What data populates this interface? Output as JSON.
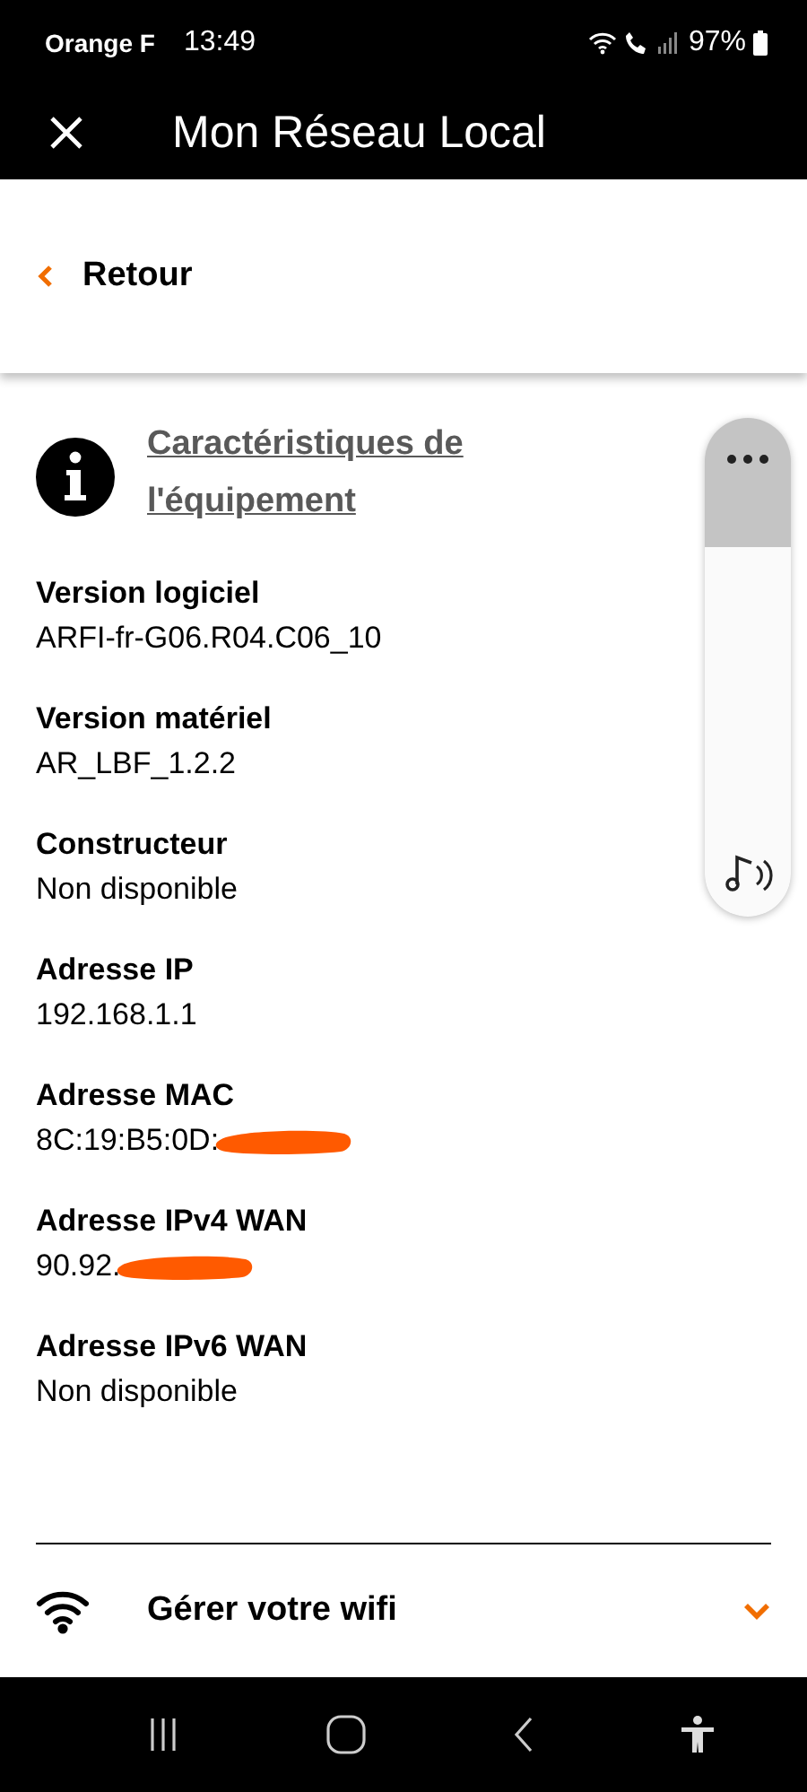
{
  "status_bar": {
    "carrier": "Orange F",
    "time": "13:49",
    "battery": "97%"
  },
  "window": {
    "title": "Mon Réseau Local"
  },
  "back_link": {
    "label": "Retour"
  },
  "section": {
    "title": "Caractéristiques de l'équipement"
  },
  "fields": [
    {
      "label": "Version logiciel",
      "value": "ARFI-fr-G06.R04.C06_10",
      "redacted": false
    },
    {
      "label": "Version matériel",
      "value": "AR_LBF_1.2.2",
      "redacted": false
    },
    {
      "label": "Constructeur",
      "value": "Non disponible",
      "redacted": false
    },
    {
      "label": "Adresse IP",
      "value": "192.168.1.1",
      "redacted": false
    },
    {
      "label": "Adresse MAC",
      "value": "8C:19:B5:0D:",
      "redacted": true
    },
    {
      "label": "Adresse IPv4 WAN",
      "value": "90.92.",
      "redacted": true
    },
    {
      "label": "Adresse IPv6 WAN",
      "value": "Non disponible",
      "redacted": false
    }
  ],
  "accordion": {
    "label": "Gérer votre wifi",
    "expanded": false
  },
  "volume": {
    "level": 0.74
  }
}
